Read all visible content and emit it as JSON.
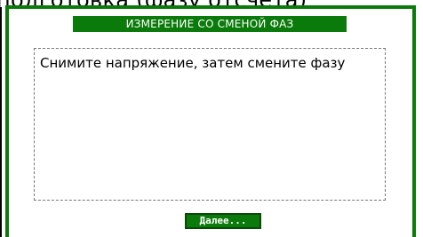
{
  "background": {
    "text": "подготовка (фазу отсчета)"
  },
  "dialog": {
    "title": "ИЗМЕРЕНИЕ СО СМЕНОЙ ФАЗ",
    "message": "Снимите напряжение, затем смените фазу",
    "next_label": "Далее..."
  },
  "colors": {
    "accent": "#0a7a0a",
    "title_text": "#ffffff"
  }
}
